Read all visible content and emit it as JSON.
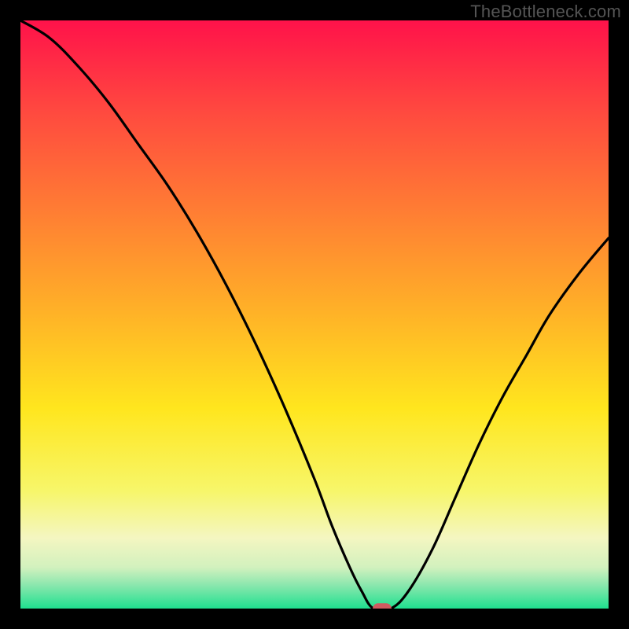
{
  "watermark": "TheBottleneck.com",
  "chart_data": {
    "type": "line",
    "title": "",
    "xlabel": "",
    "ylabel": "",
    "xlim": [
      0,
      100
    ],
    "ylim": [
      0,
      100
    ],
    "gradient_stops": [
      {
        "offset": 0,
        "color": "#ff124a"
      },
      {
        "offset": 16,
        "color": "#ff4b3f"
      },
      {
        "offset": 33,
        "color": "#ff7f33"
      },
      {
        "offset": 50,
        "color": "#ffb327"
      },
      {
        "offset": 66,
        "color": "#ffe61e"
      },
      {
        "offset": 80,
        "color": "#f7f66a"
      },
      {
        "offset": 88,
        "color": "#f4f6c1"
      },
      {
        "offset": 93,
        "color": "#d2f1be"
      },
      {
        "offset": 96,
        "color": "#8be7ae"
      },
      {
        "offset": 100,
        "color": "#1fe08f"
      }
    ],
    "series": [
      {
        "name": "bottleneck",
        "x": [
          0,
          5,
          10,
          15,
          20,
          25,
          30,
          35,
          40,
          45,
          50,
          53,
          56,
          58,
          60,
          63,
          66,
          70,
          74,
          78,
          82,
          86,
          90,
          95,
          100
        ],
        "y": [
          100,
          97,
          92,
          86,
          79,
          72,
          64,
          55,
          45,
          34,
          22,
          14,
          7,
          3,
          0,
          0,
          3,
          10,
          19,
          28,
          36,
          43,
          50,
          57,
          63
        ]
      }
    ],
    "marker": {
      "x": 61.5,
      "y": 0,
      "width_pct": 3.2,
      "height_pct": 1.8,
      "color": "#cf5b60"
    }
  }
}
